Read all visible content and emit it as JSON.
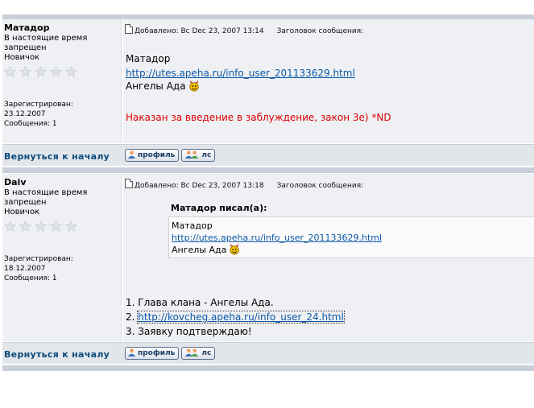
{
  "post1": {
    "username": "Матадор",
    "status_line1": "В настоящие время",
    "status_line2": "запрещен",
    "rank": "Новичок",
    "registered_label": "Зарегистрирован:",
    "registered_date": "23.12.2007",
    "messages": "Сообщения: 1",
    "added": "Добавлено: Вс Dec 23, 2007 13:14",
    "subject_label": "Заголовок сообщения:",
    "body_line1": "Матадор",
    "body_link": "http://utes.apeha.ru/info_user_201133629.html",
    "body_line3": "Ангелы Ада",
    "penalty": "Наказан за введение в заблуждение, закон 3е) *ND",
    "back_to_top": "Вернуться к началу",
    "profile_btn": "профиль",
    "pm_btn": "лс"
  },
  "post2": {
    "username": "Daiv",
    "status_line1": "В настоящие время",
    "status_line2": "запрещен",
    "rank": "Новичок",
    "registered_label": "Зарегистрирован:",
    "registered_date": "18.12.2007",
    "messages": "Сообщения: 1",
    "added": "Добавлено: Вс Dec 23, 2007 13:18",
    "subject_label": "Заголовок сообщения:",
    "quote_header": "Матадор писал(а):",
    "quote_line1": "Матадор",
    "quote_link": "http://utes.apeha.ru/info_user_201133629.html",
    "quote_line3": "Ангелы Ада",
    "item1": "1. Глава клана - Ангелы Ада.",
    "item2_prefix": "2. ",
    "item2_link": "http://kovcheg.apeha.ru/info_user_24.html",
    "item3": "3. Заявку подтверждаю!",
    "back_to_top": "Вернуться к началу",
    "profile_btn": "профиль",
    "pm_btn": "лс"
  },
  "colors": {
    "panel": "#eef0f3",
    "link": "#0b59a8",
    "penalty": "#e00000",
    "footer": "#e2e6eb",
    "star": "#d8dce2"
  },
  "icons": {
    "star": "star-icon",
    "doc": "post-doc-icon",
    "smile": "devil-smile-icon",
    "profile": "user-icon",
    "pm": "users-icon"
  }
}
